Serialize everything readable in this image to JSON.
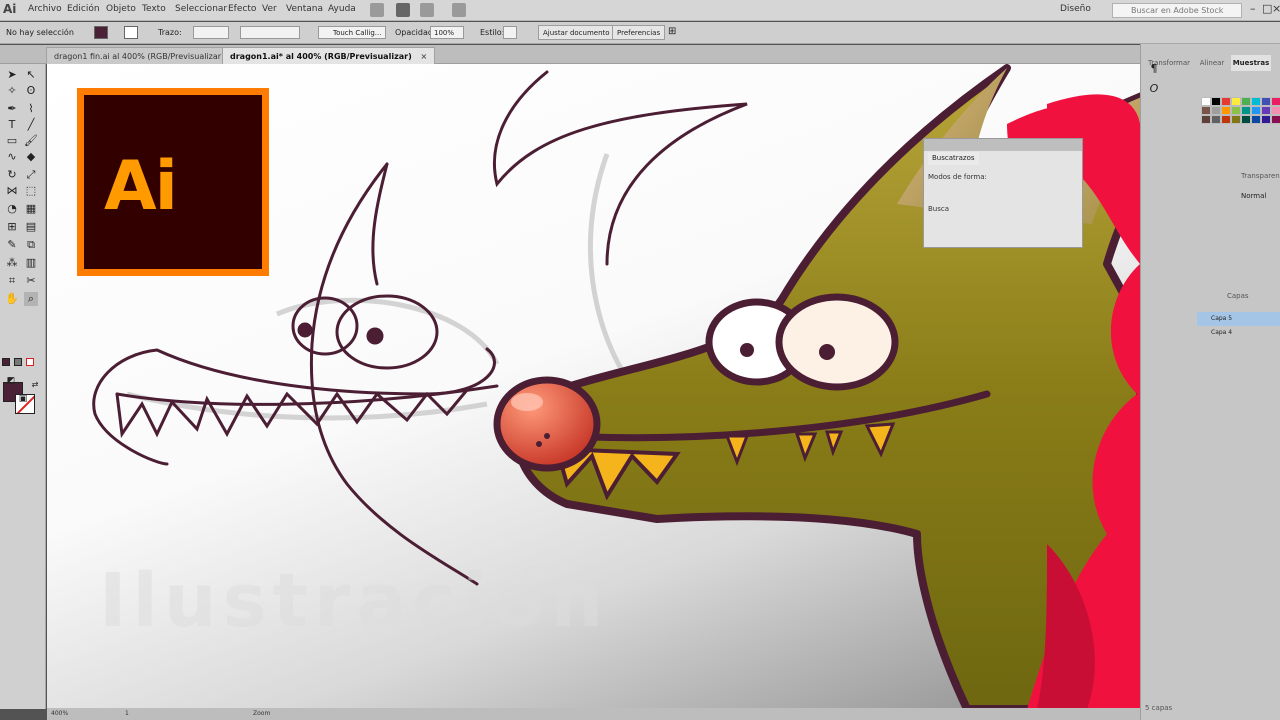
{
  "app": {
    "logo": "Ai"
  },
  "menu": {
    "items": [
      "Archivo",
      "Edición",
      "Objeto",
      "Texto",
      "Seleccionar",
      "Efecto",
      "Ver",
      "Ventana",
      "Ayuda"
    ],
    "workspace": "Diseño",
    "search_placeholder": "Buscar en Adobe Stock"
  },
  "control_bar": {
    "selection": "No hay selección",
    "stroke_label": "Trazo:",
    "brush": "Touch Callig...",
    "opacity_label": "Opacidad:",
    "opacity_value": "100%",
    "style_label": "Estilo:",
    "adjust_button": "Ajustar documento",
    "preferences_button": "Preferencias"
  },
  "tabs": [
    {
      "label": "dragon1 fin.ai al 400% (RGB/Previsualizar)",
      "close": "×"
    },
    {
      "label": "dragon1.ai* al 400% (RGB/Previsualizar)",
      "close": "×"
    }
  ],
  "canvas": {
    "logo_text": "Ai",
    "title": "Ilustración"
  },
  "floating_panel": {
    "title": "Buscatrazos",
    "modes_label": "Modos de forma:",
    "search_label": "Busca"
  },
  "right_panels": {
    "tabs": [
      "Transformar",
      "Alinear",
      "Muestras"
    ],
    "transparency_label": "Transparencia",
    "blend_mode": "Normal",
    "layers_label": "Capas",
    "layers": [
      "Capa 5",
      "Capa 4"
    ],
    "layers_count": "5 capas"
  },
  "status": {
    "zoom": "400%",
    "page": "1",
    "mode": "Zoom"
  },
  "colors": {
    "ai_brand_orange": "#ff7c00",
    "ai_brand_bg": "#330000",
    "dragon_head": "#8a7d18",
    "dragon_mane": "#f0113f",
    "dragon_nose": "#e0533a",
    "outline": "#4b1e34"
  }
}
